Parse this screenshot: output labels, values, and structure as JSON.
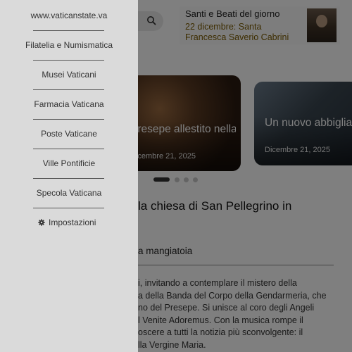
{
  "page": {
    "saints": {
      "title": "Santi e Beati del giorno",
      "name": "22 dicembre: Santa Francesca Saverio Cabrini"
    },
    "cards": [
      {
        "title": "Presepe allestito nella chiesa di San P...",
        "date": "Dicembre 21, 2025"
      },
      {
        "title": "Un nuovo abbigliamento op",
        "date": "Dicembre 21, 2025"
      }
    ],
    "carousel": {
      "pages": 4,
      "active_index": 0
    },
    "article": {
      "title": "la chiesa di San Pellegrino in",
      "section_title": "a mangiatoia",
      "body_lines": [
        "i, invitando a contemplare il mistero della",
        "a della Banda del Corpo della Gendarmeria, che",
        "no del Presepe. Si unisce al coro degli Angeli",
        "l Venite Adoremus. Con la musica rompe il",
        "oscere a tutti la notizia più sconvolgente: il",
        "lla Vergine Maria."
      ]
    }
  },
  "drawer": {
    "items": [
      "www.vaticanstate.va",
      "Filatelia e Numismatica",
      "Musei Vaticani",
      "Farmacia Vaticana",
      "Poste Vaticane",
      "Ville Pontificie",
      "Specola Vaticana"
    ],
    "settings_label": "Impostazioni"
  },
  "colors": {
    "drawer_bg": "#dadada",
    "overlay": "rgba(0,0,0,0.5)",
    "saint_name": "#7a5a00"
  }
}
